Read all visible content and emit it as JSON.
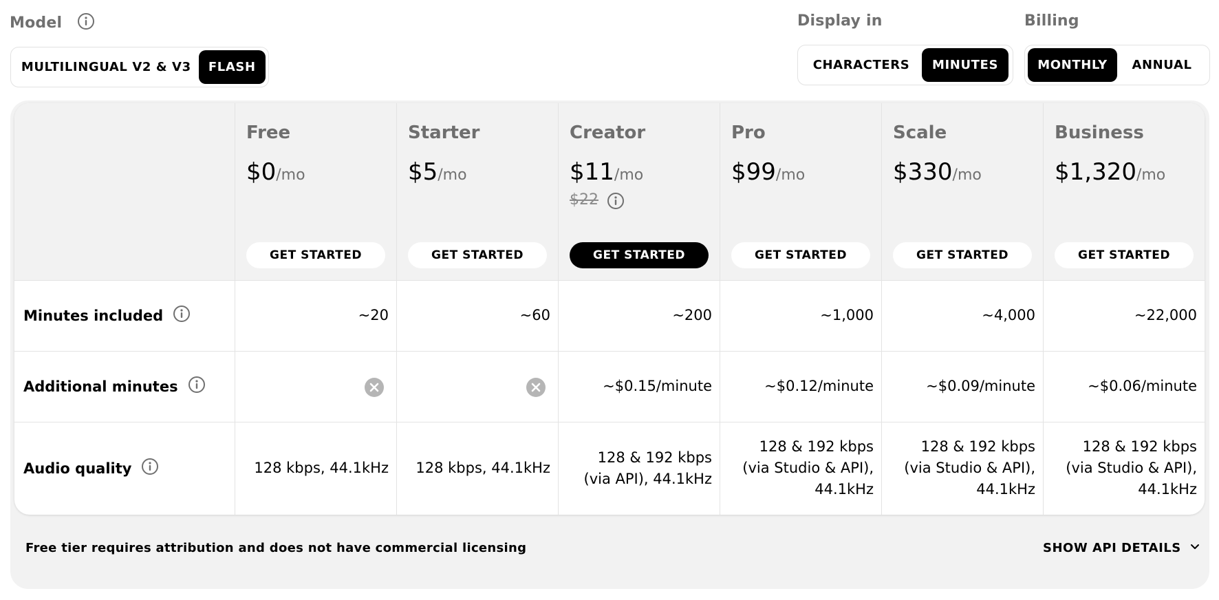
{
  "model": {
    "label": "Model",
    "options": [
      "MULTILINGUAL V2 & V3",
      "FLASH"
    ],
    "selected": "FLASH"
  },
  "display": {
    "label": "Display in",
    "options": [
      "CHARACTERS",
      "MINUTES"
    ],
    "selected": "MINUTES"
  },
  "billing": {
    "label": "Billing",
    "options": [
      "MONTHLY",
      "ANNUAL"
    ],
    "selected": "MONTHLY"
  },
  "plans": [
    {
      "name": "Free",
      "price": "$0",
      "per": "/mo",
      "cta": "GET STARTED"
    },
    {
      "name": "Starter",
      "price": "$5",
      "per": "/mo",
      "cta": "GET STARTED"
    },
    {
      "name": "Creator",
      "price": "$11",
      "per": "/mo",
      "original_price": "$22",
      "cta": "GET STARTED"
    },
    {
      "name": "Pro",
      "price": "$99",
      "per": "/mo",
      "cta": "GET STARTED"
    },
    {
      "name": "Scale",
      "price": "$330",
      "per": "/mo",
      "cta": "GET STARTED"
    },
    {
      "name": "Business",
      "price": "$1,320",
      "per": "/mo",
      "cta": "GET STARTED"
    }
  ],
  "rows": [
    {
      "label": "Minutes included",
      "values": [
        "~20",
        "~60",
        "~200",
        "~1,000",
        "~4,000",
        "~22,000"
      ]
    },
    {
      "label": "Additional minutes",
      "values": [
        "",
        "",
        "~$0.15/minute",
        "~$0.12/minute",
        "~$0.09/minute",
        "~$0.06/minute"
      ],
      "not_available": [
        true,
        true,
        false,
        false,
        false,
        false
      ]
    },
    {
      "label": "Audio quality",
      "values": [
        "128 kbps, 44.1kHz",
        "128 kbps, 44.1kHz",
        "128 & 192 kbps (via API), 44.1kHz",
        "128 & 192 kbps (via Studio & API), 44.1kHz",
        "128 & 192 kbps (via Studio & API), 44.1kHz",
        "128 & 192 kbps (via Studio & API), 44.1kHz"
      ]
    }
  ],
  "footer": {
    "note": "Free tier requires attribution and does not have commercial licensing",
    "api_toggle": "SHOW API DETAILS"
  },
  "colors": {
    "accent": "#000000",
    "muted": "#707070",
    "panel": "#f2f2f2",
    "border": "#e3e3e3"
  }
}
